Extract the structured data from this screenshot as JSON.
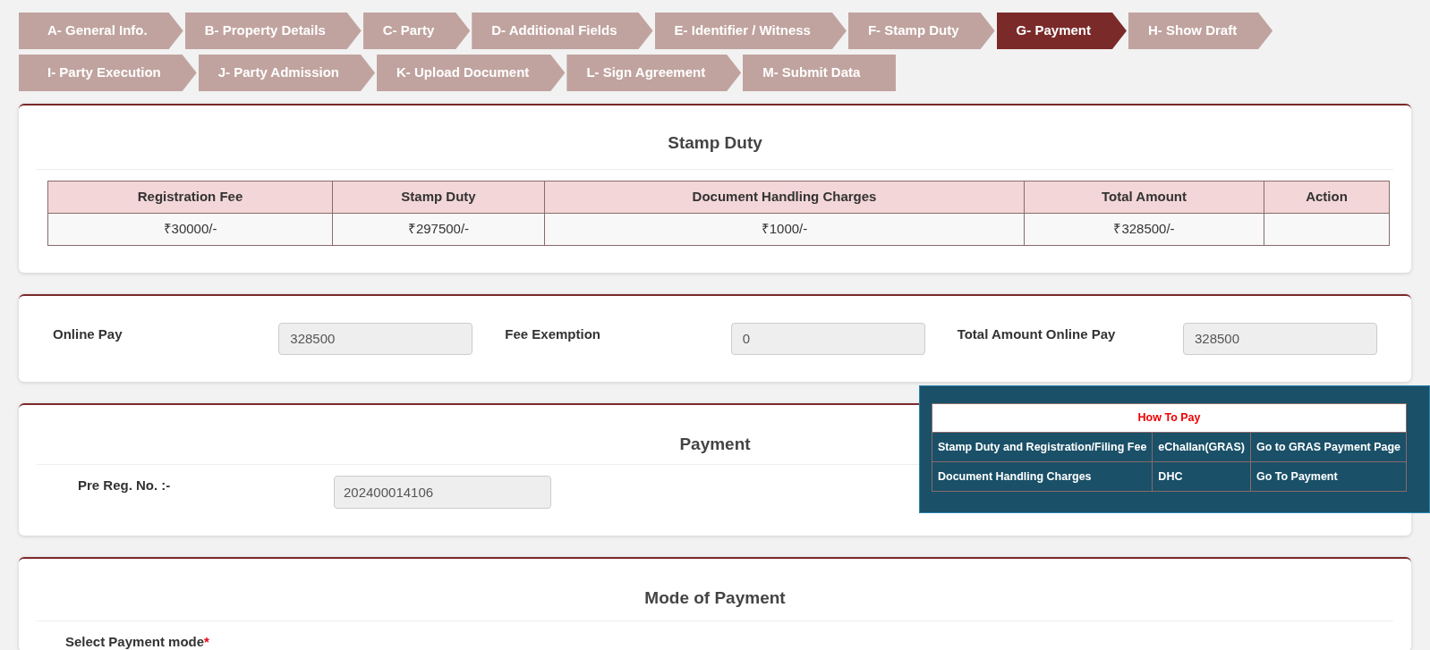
{
  "steps": [
    [
      {
        "label": "A- General Info.",
        "selected": false
      },
      {
        "label": "B- Property Details",
        "selected": false
      },
      {
        "label": "C- Party",
        "selected": false
      },
      {
        "label": "D- Additional Fields",
        "selected": false
      },
      {
        "label": "E- Identifier / Witness",
        "selected": false
      },
      {
        "label": "F- Stamp Duty",
        "selected": false
      },
      {
        "label": "G- Payment",
        "selected": true
      },
      {
        "label": "H- Show Draft",
        "selected": false
      }
    ],
    [
      {
        "label": "I- Party Execution",
        "selected": false
      },
      {
        "label": "J- Party Admission",
        "selected": false
      },
      {
        "label": "K- Upload Document",
        "selected": false
      },
      {
        "label": "L- Sign Agreement",
        "selected": false
      },
      {
        "label": "M- Submit Data",
        "selected": false
      }
    ]
  ],
  "stamp_duty": {
    "title": "Stamp Duty",
    "columns": [
      "Registration Fee",
      "Stamp Duty",
      "Document Handling Charges",
      "Total Amount",
      "Action"
    ],
    "rows": [
      [
        "₹30000/-",
        "₹297500/-",
        "₹1000/-",
        "₹328500/-",
        ""
      ]
    ]
  },
  "fees": [
    {
      "label": "Online Pay",
      "value": "328500"
    },
    {
      "label": "Fee Exemption",
      "value": "0"
    },
    {
      "label": "Total Amount Online Pay",
      "value": "328500"
    }
  ],
  "payment": {
    "title": "Payment",
    "pre_reg_label": "Pre Reg. No. :-",
    "pre_reg_value": "202400014106"
  },
  "how_to_pay": {
    "title": "How To Pay",
    "rows": [
      [
        "Stamp Duty and Registration/Filing Fee",
        "eChallan(GRAS)",
        "Go to GRAS Payment Page"
      ],
      [
        "Document Handling Charges",
        "DHC",
        "Go To Payment"
      ]
    ]
  },
  "mode_of_payment": {
    "title": "Mode of Payment",
    "label": "Select Payment mode",
    "required_mark": "*"
  }
}
